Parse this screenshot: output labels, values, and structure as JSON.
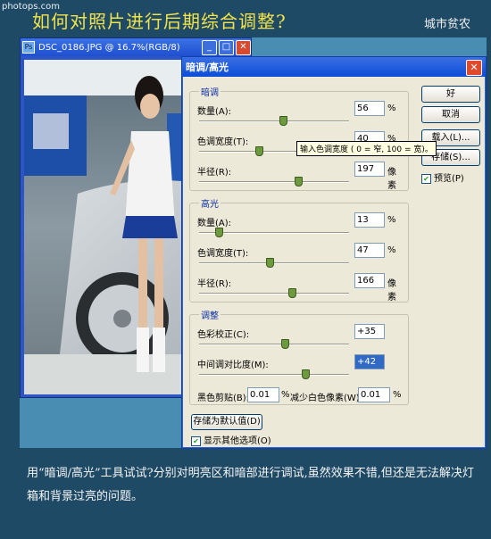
{
  "watermark": "photops.com",
  "page_title": "如何对照片进行后期综合调整?",
  "author": "城市贫农",
  "image_window": {
    "title": "DSC_0186.JPG @ 16.7%(RGB/8)",
    "buttons": [
      "_",
      "□",
      "✕"
    ]
  },
  "dialog": {
    "title": "暗调/高光",
    "shadows": {
      "group": "暗调",
      "amount_label": "数量(A):",
      "amount": "56",
      "amount_unit": "%",
      "amount_pct": 56,
      "tonal_label": "色调宽度(T):",
      "tonal": "40",
      "tonal_unit": "%",
      "tonal_pct": 40,
      "radius_label": "半径(R):",
      "radius": "197",
      "radius_unit": "像素",
      "radius_pct": 66
    },
    "highlights": {
      "group": "高光",
      "amount_label": "数量(A):",
      "amount": "13",
      "amount_unit": "%",
      "amount_pct": 13,
      "tonal_label": "色调宽度(T):",
      "tonal": "47",
      "tonal_unit": "%",
      "tonal_pct": 47,
      "radius_label": "半径(R):",
      "radius": "166",
      "radius_unit": "像素",
      "radius_pct": 62
    },
    "adjust": {
      "group": "调整",
      "color_label": "色彩校正(C):",
      "color": "+35",
      "color_pct": 57,
      "contrast_label": "中间调对比度(M):",
      "contrast": "+42",
      "contrast_pct": 71,
      "black_label": "黑色剪贴(B):",
      "black": "0.01",
      "black_unit": "%",
      "white_label": "减少白色像素(W):",
      "white": "0.01",
      "white_unit": "%"
    },
    "save_default": "存储为默认值(D)",
    "show_more": "显示其他选项(O)",
    "buttons": {
      "ok": "好",
      "cancel": "取消",
      "load": "载入(L)...",
      "save": "存储(S)..."
    },
    "preview": "预览(P)",
    "tooltip": "输入色调宽度 ( 0 = 窄, 100 = 宽)。"
  },
  "caption": "用“暗调/高光”工具试试?分别对明亮区和暗部进行调试,虽然效果不错,但还是无法解决灯箱和背景过亮的问题。"
}
